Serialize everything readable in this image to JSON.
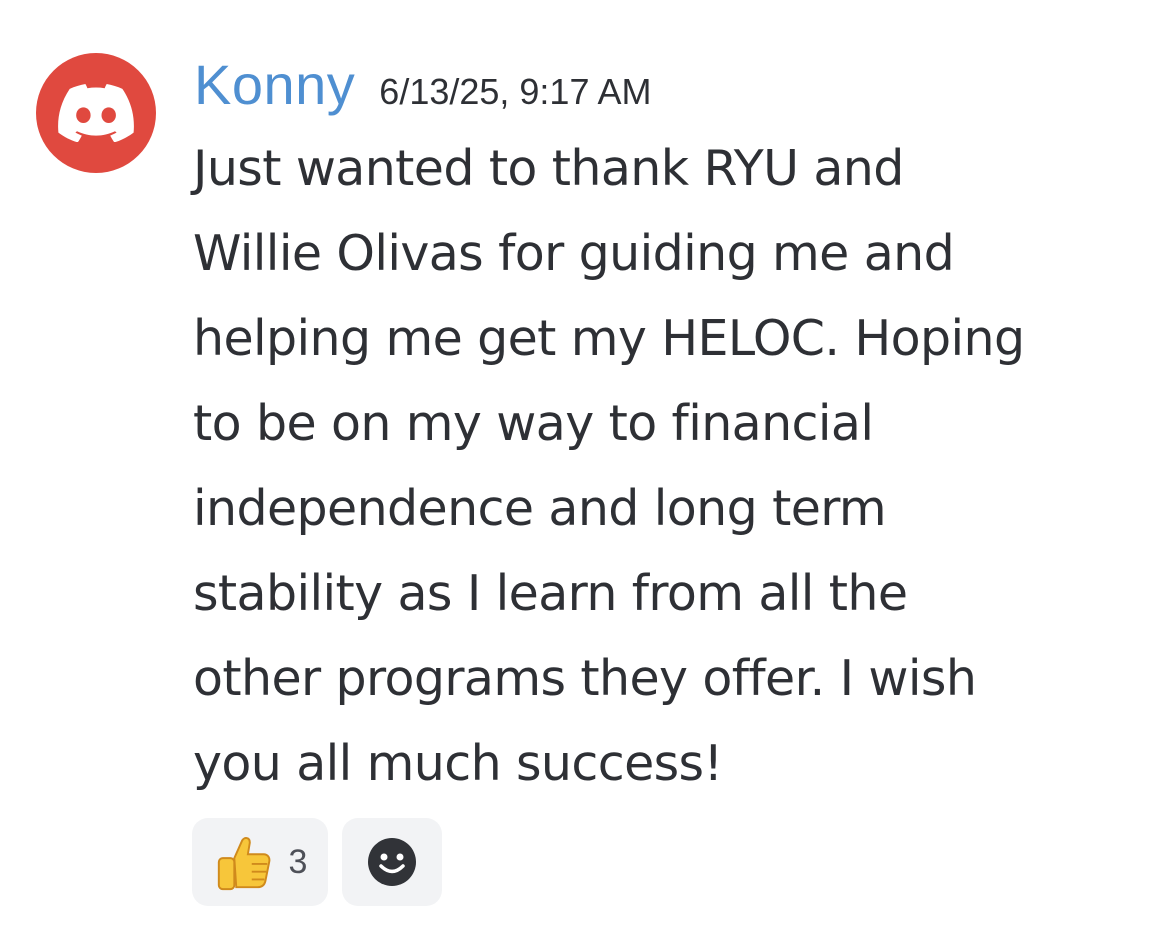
{
  "message": {
    "author": "Konny",
    "timestamp": "6/13/25, 9:17 AM",
    "content_lines": [
      "Just wanted to thank RYU and",
      "Willie Olivas for guiding me and",
      "helping me get my HELOC. Hoping",
      "to be on my way to financial",
      "independence and long term",
      "stability as I learn from all the",
      "other programs they offer. I wish",
      "you all much success!"
    ],
    "avatar_icon": "discord-logo-icon",
    "avatar_color": "#e0493f",
    "author_color": "#4f8fd1"
  },
  "reactions": [
    {
      "emoji_icon": "thumbs-up-icon",
      "count": "3"
    }
  ],
  "add_reaction_icon": "smiley-face-icon"
}
